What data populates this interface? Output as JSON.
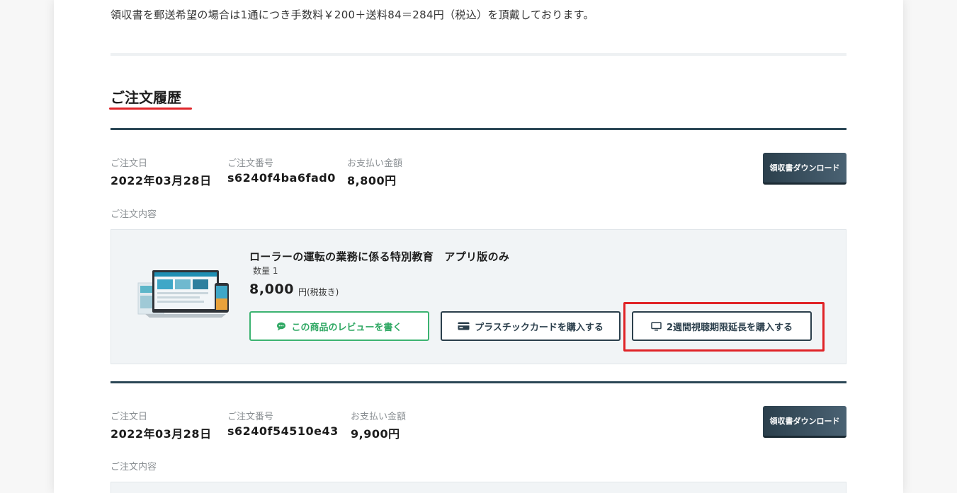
{
  "notice": {
    "text": "領収書を郵送希望の場合は1通につき手数料￥200＋送料84＝284円（税込）を頂戴しております。"
  },
  "section": {
    "title": "ご注文履歴"
  },
  "labels": {
    "order_date": "ご注文日",
    "order_number": "ご注文番号",
    "payment_amount": "お支払い金額",
    "order_contents": "ご注文内容",
    "receipt_download": "領収書ダウンロード"
  },
  "orders": [
    {
      "date": "2022年03月28日",
      "number": "s6240f4ba6fad0",
      "amount": "8,800円",
      "item": {
        "title": "ローラーの運転の業務に係る特別教育　アプリ版のみ",
        "quantity": "数量 1",
        "price": "8,000",
        "price_unit": "円(税抜き)",
        "buttons": {
          "review": "この商品のレビューを書く",
          "plastic_card": "プラスチックカードを購入する",
          "extension": "2週間視聴期限延長を購入する"
        }
      }
    },
    {
      "date": "2022年03月28日",
      "number": "s6240f54510e43",
      "amount": "9,900円"
    }
  ],
  "colors": {
    "accent_red": "#e0262b",
    "dark_navy": "#2b3f4c",
    "review_green": "#3cb371",
    "highlight_red": "#e02327"
  },
  "icons": {
    "review": "chat-bubble-icon",
    "plastic_card": "credit-card-icon",
    "extension": "monitor-icon"
  }
}
